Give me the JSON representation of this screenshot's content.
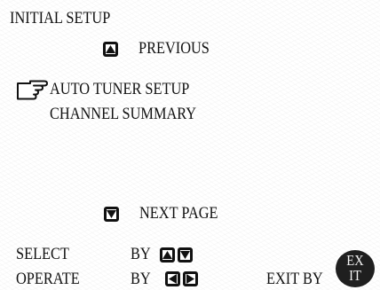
{
  "menu": {
    "title": "INITIAL SETUP",
    "previous_label": "PREVIOUS",
    "items": [
      {
        "label": "AUTO TUNER SETUP"
      },
      {
        "label": "CHANNEL SUMMARY"
      }
    ],
    "selected_index": 0,
    "next_page_label": "NEXT PAGE"
  },
  "footer": {
    "select_label": "SELECT",
    "select_by": "BY",
    "operate_label": "OPERATE",
    "operate_by": "BY",
    "exit_label": "EXIT BY",
    "exit_badge_line1": "EX",
    "exit_badge_line2": "IT"
  },
  "icons": {
    "previous": "up-arrow-button-icon",
    "next": "down-arrow-button-icon",
    "pointer": "pointing-hand-icon",
    "select": [
      "up-arrow-button-icon",
      "down-arrow-button-icon"
    ],
    "operate": [
      "left-arrow-button-icon",
      "right-arrow-button-icon"
    ],
    "exit": "exit-button-icon"
  },
  "colors": {
    "background": "#ffffff",
    "text": "#111111",
    "exit_badge": "#1f1f1f"
  }
}
